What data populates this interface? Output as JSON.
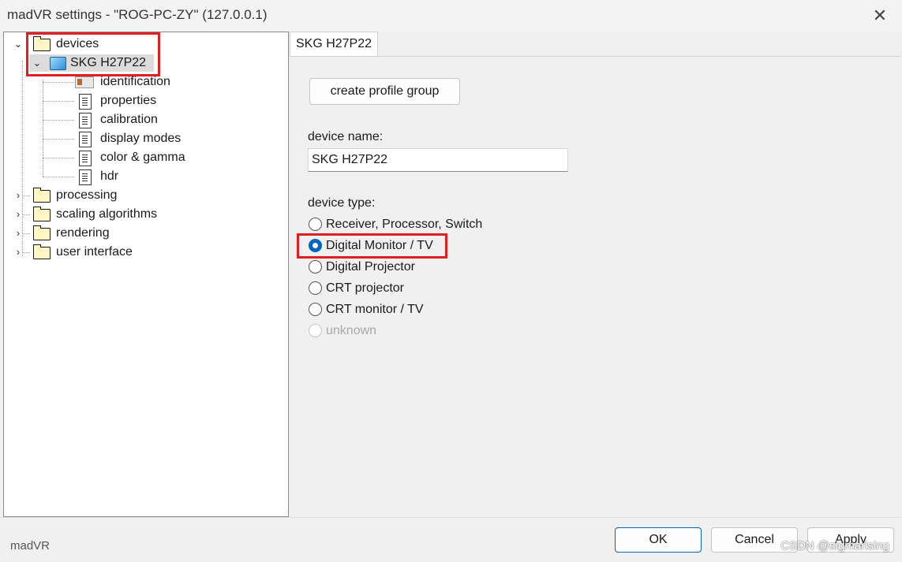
{
  "window": {
    "title": "madVR settings - \"ROG-PC-ZY\" (127.0.0.1)",
    "close_glyph": "✕"
  },
  "tree": {
    "devices": "devices",
    "device": "SKG H27P22",
    "device_children": [
      "identification",
      "properties",
      "calibration",
      "display modes",
      "color & gamma",
      "hdr"
    ],
    "sections": [
      "processing",
      "scaling algorithms",
      "rendering",
      "user interface"
    ]
  },
  "tab": {
    "label": "SKG H27P22"
  },
  "pane": {
    "create_group_button": "create profile group",
    "device_name_label": "device name:",
    "device_name_value": "SKG H27P22",
    "device_type_label": "device type:",
    "device_types": [
      "Receiver, Processor, Switch",
      "Digital Monitor / TV",
      "Digital Projector",
      "CRT projector",
      "CRT monitor / TV",
      "unknown"
    ],
    "selected_device_type": "Digital Monitor / TV"
  },
  "footer": {
    "brand": "madVR",
    "ok": "OK",
    "cancel": "Cancel",
    "apply": "Apply",
    "watermark": "CSDN @sigmarising"
  },
  "colors": {
    "accent": "#0067c0",
    "highlight_box": "#e02020"
  }
}
